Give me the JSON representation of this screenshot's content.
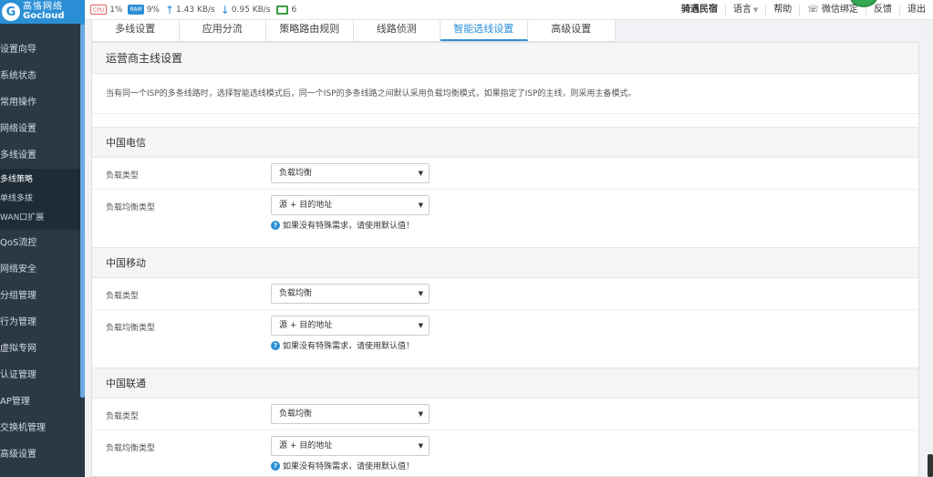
{
  "brand": {
    "name_cn": "高恪网络",
    "name_en": "Gocloud",
    "logo_glyph": "G"
  },
  "topbar": {
    "cpu_chip": "CPU",
    "cpu_value": "1%",
    "ram_chip": "RAM",
    "ram_value": "9%",
    "up_speed": "1.43 KB/s",
    "down_speed": "0.95 KB/s",
    "device_count": "6",
    "user": "骑遇民宿",
    "language": "语言",
    "help": "帮助",
    "wechat": "微信绑定",
    "feedback": "反馈",
    "logout": "退出"
  },
  "sidebar": {
    "items_top": [
      "设置向导",
      "系统状态",
      "常用操作",
      "网络设置",
      "多线设置"
    ],
    "subitems": [
      "多线策略",
      "单线多拨",
      "WAN口扩展"
    ],
    "items_bottom": [
      "QoS流控",
      "网络安全",
      "分组管理",
      "行为管理",
      "虚拟专网",
      "认证管理",
      "AP管理",
      "交换机管理",
      "高级设置"
    ]
  },
  "tabs": [
    "多线设置",
    "应用分流",
    "策略路由规则",
    "线路侦测",
    "智能选线设置",
    "高级设置"
  ],
  "active_tab": "智能选线设置",
  "panel": {
    "title": "运营商主线设置",
    "description": "当有同一个ISP的多条线路时，选择智能选线模式后，同一个ISP的多条线路之间默认采用负载均衡模式，如果指定了ISP的主线，则采用主备模式。",
    "sections": [
      {
        "isp": "中国电信",
        "load_type_label": "负载类型",
        "load_type_value": "负载均衡",
        "balance_label": "负载均衡类型",
        "balance_value": "源 + 目的地址",
        "hint": "如果没有特殊需求，请使用默认值！"
      },
      {
        "isp": "中国移动",
        "load_type_label": "负载类型",
        "load_type_value": "负载均衡",
        "balance_label": "负载均衡类型",
        "balance_value": "源 + 目的地址",
        "hint": "如果没有特殊需求，请使用默认值！"
      },
      {
        "isp": "中国联通",
        "load_type_label": "负载类型",
        "load_type_value": "负载均衡",
        "balance_label": "负载均衡类型",
        "balance_value": "源 + 目的地址",
        "hint": "如果没有特殊需求，请使用默认值！"
      }
    ]
  },
  "colors": {
    "accent": "#2b8fd6",
    "sidebar": "#2a3946",
    "active_text": "#ffffff"
  }
}
